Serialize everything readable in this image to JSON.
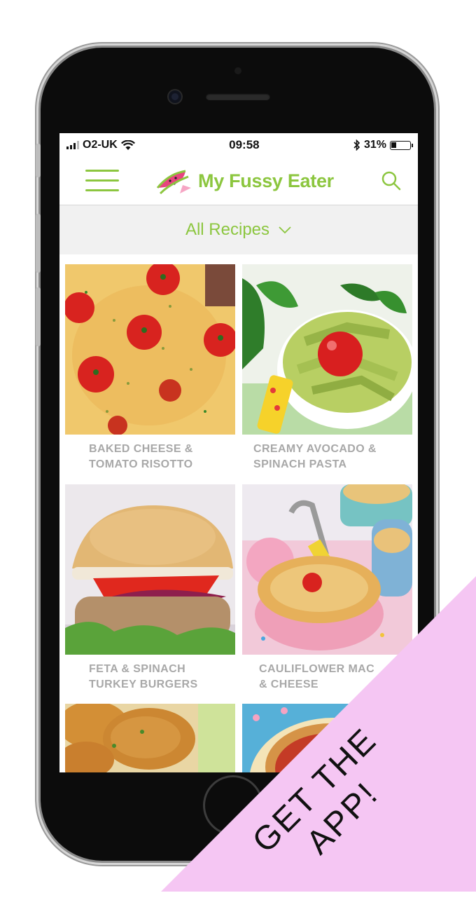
{
  "status_bar": {
    "carrier": "O2-UK",
    "time": "09:58",
    "battery": "31%",
    "battery_level": 0.31
  },
  "header": {
    "app_title": "My Fussy Eater",
    "brand_color": "#8cc63f"
  },
  "filter": {
    "label": "All Recipes"
  },
  "recipes": [
    {
      "line1": "BAKED CHEESE &",
      "line2": "TOMATO RISOTTO"
    },
    {
      "line1": "CREAMY AVOCADO &",
      "line2": "SPINACH PASTA"
    },
    {
      "line1": "FETA & SPINACH",
      "line2": "TURKEY BURGERS"
    },
    {
      "line1": "CAULIFLOWER MAC",
      "line2": "& CHEESE"
    }
  ],
  "banner": {
    "line1": "GET THE",
    "line2": "APP!",
    "color": "#f5c6f3"
  }
}
